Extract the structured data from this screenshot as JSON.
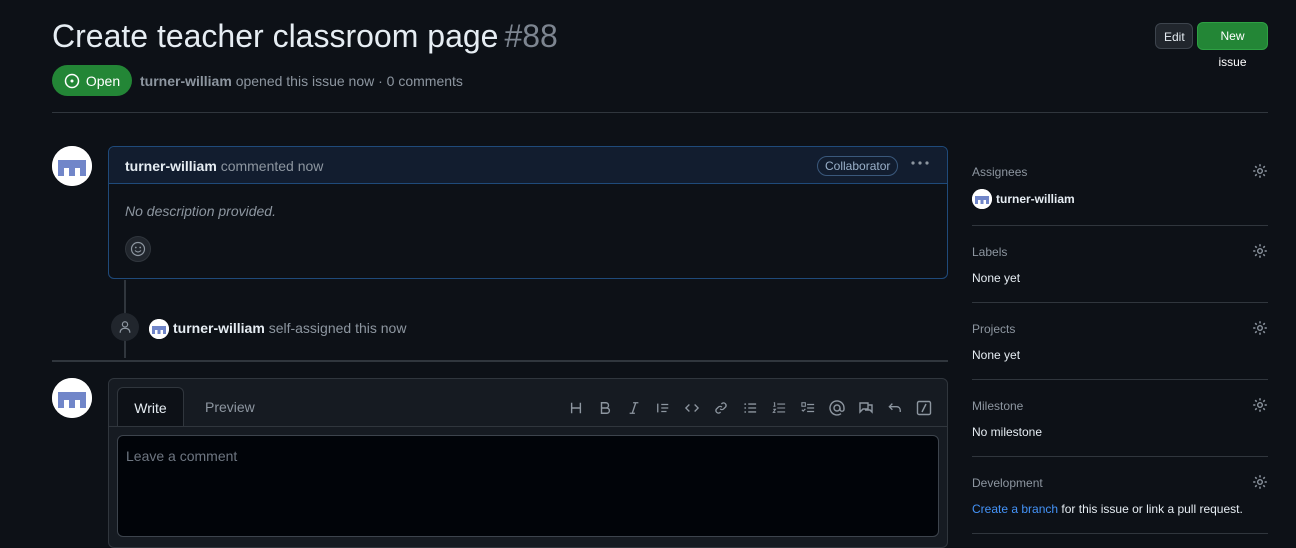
{
  "issue": {
    "title": "Create teacher classroom page",
    "number": "#88",
    "state": "Open",
    "author": "turner-william",
    "meta_text": "opened this issue now · 0 comments"
  },
  "header_buttons": {
    "edit": "Edit",
    "new_issue": "New issue"
  },
  "comment": {
    "author": "turner-william",
    "action": "commented now",
    "role_badge": "Collaborator",
    "body": "No description provided."
  },
  "event": {
    "actor": "turner-william",
    "action": "self-assigned this now"
  },
  "editor": {
    "tab_write": "Write",
    "tab_preview": "Preview",
    "placeholder": "Leave a comment",
    "toolbar": [
      "heading-icon",
      "bold-icon",
      "italic-icon",
      "quote-icon",
      "code-icon",
      "link-icon",
      "unordered-list-icon",
      "ordered-list-icon",
      "task-list-icon",
      "mention-icon",
      "reference-icon",
      "undo-icon",
      "slash-command-icon"
    ]
  },
  "sidebar": {
    "assignees": {
      "label": "Assignees",
      "value": "turner-william"
    },
    "labels": {
      "label": "Labels",
      "value": "None yet"
    },
    "projects": {
      "label": "Projects",
      "value": "None yet"
    },
    "milestone": {
      "label": "Milestone",
      "value": "No milestone"
    },
    "development": {
      "label": "Development",
      "link": "Create a branch",
      "suffix": "for this issue or link a pull request."
    }
  },
  "colors": {
    "open_green": "#238636",
    "link_blue": "#4493f8",
    "background": "#0d1117"
  }
}
